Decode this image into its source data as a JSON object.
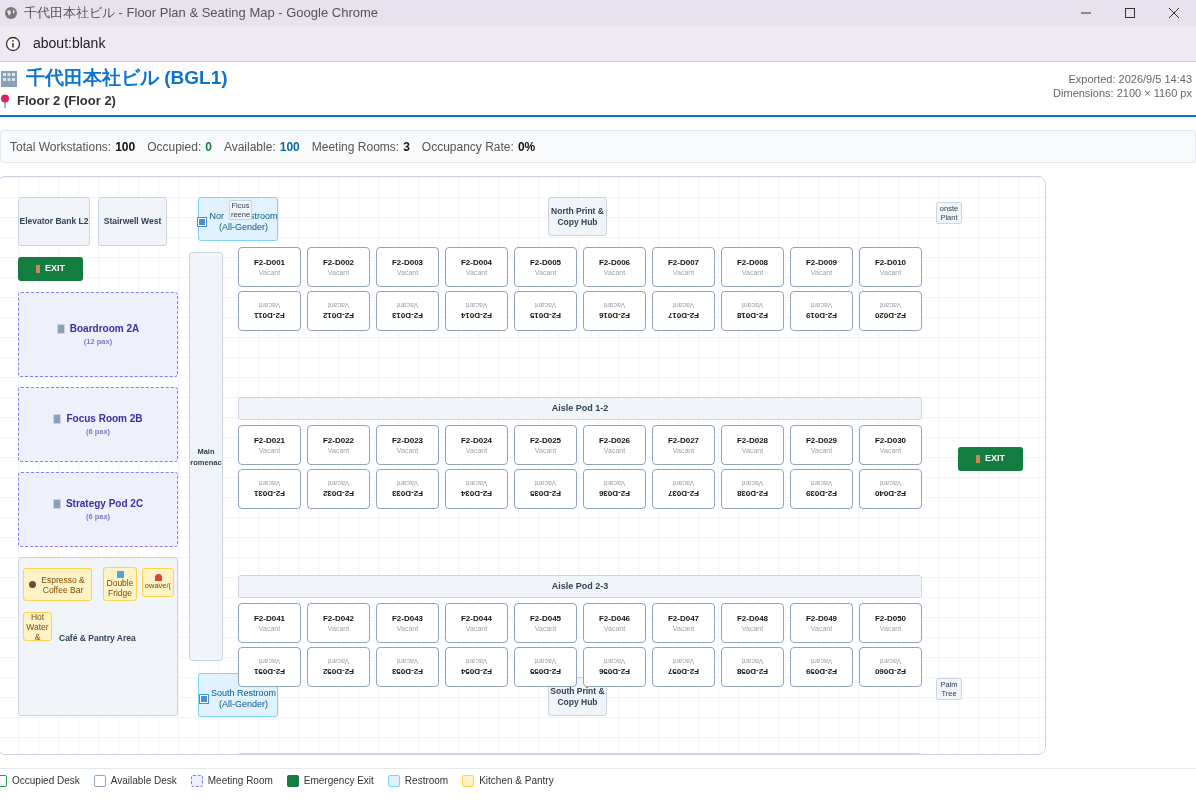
{
  "window": {
    "title": "千代田本社ビル - Floor Plan & Seating Map - Google Chrome"
  },
  "address_bar": {
    "url": "about:blank"
  },
  "header": {
    "building": "千代田本社ビル (BGL1)",
    "floor": "Floor 2 (Floor 2)",
    "exported": "Exported: 2026/9/5 14:43",
    "dimensions": "Dimensions: 2100 × 1160 px"
  },
  "stats": [
    {
      "label": "Total Workstations:",
      "value": "100",
      "kind": "total"
    },
    {
      "label": "Occupied:",
      "value": "0",
      "kind": "occupied"
    },
    {
      "label": "Available:",
      "value": "100",
      "kind": "available"
    },
    {
      "label": "Meeting Rooms:",
      "value": "3",
      "kind": "rooms"
    },
    {
      "label": "Occupancy Rate:",
      "value": "0%",
      "kind": "rate"
    }
  ],
  "floor_plan": {
    "facilities": [
      {
        "label": "Elevator Bank L2"
      },
      {
        "label": "Stairwell West"
      },
      {
        "label": "North Print & Copy Hub"
      },
      {
        "label": "South Print & Copy Hub"
      }
    ],
    "restrooms": [
      {
        "label": "Nor",
        "label_end": "stroom",
        "note": "(All-Gender)"
      },
      {
        "label": "South Restroom",
        "note": "(All-Gender)"
      }
    ],
    "exits": [
      {
        "label": "EXIT"
      },
      {
        "label": "EXIT"
      }
    ],
    "meeting_rooms": [
      {
        "name": "Boardroom 2A",
        "capacity": "(12 pax)"
      },
      {
        "name": "Focus Room 2B",
        "capacity": "(6 pax)"
      },
      {
        "name": "Strategy Pod 2C",
        "capacity": "(6 pax)"
      }
    ],
    "pantry": {
      "label": "Café & Pantry Area",
      "items": [
        {
          "kind": "coffee",
          "label": "Espresso & Coffee Bar"
        },
        {
          "kind": "fridge",
          "label": "Double Fridge"
        },
        {
          "kind": "microwave",
          "label": "owave/("
        },
        {
          "kind": "water",
          "label": "Hot Water &"
        }
      ]
    },
    "promenade": {
      "label": "Main romenac"
    },
    "plants": [
      {
        "label": "Ficus reene"
      },
      {
        "label": "onste Plant"
      },
      {
        "label": "Palm Tree"
      }
    ],
    "pods": [
      {
        "desks": [
          {
            "id": "F2-D001",
            "status": "Vacant",
            "occupied": false
          },
          {
            "id": "F2-D002",
            "status": "Vacant",
            "occupied": false
          },
          {
            "id": "F2-D003",
            "status": "Vacant",
            "occupied": false
          },
          {
            "id": "F2-D004",
            "status": "Vacant",
            "occupied": false
          },
          {
            "id": "F2-D005",
            "status": "Vacant",
            "occupied": false
          },
          {
            "id": "F2-D006",
            "status": "Vacant",
            "occupied": false
          },
          {
            "id": "F2-D007",
            "status": "Vacant",
            "occupied": false
          },
          {
            "id": "F2-D008",
            "status": "Vacant",
            "occupied": false
          },
          {
            "id": "F2-D009",
            "status": "Vacant",
            "occupied": false
          },
          {
            "id": "F2-D010",
            "status": "Vacant",
            "occupied": false
          },
          {
            "id": "F2-D011",
            "status": "Vacant",
            "occupied": false
          },
          {
            "id": "F2-D012",
            "status": "Vacant",
            "occupied": false
          },
          {
            "id": "F2-D013",
            "status": "Vacant",
            "occupied": false
          },
          {
            "id": "F2-D014",
            "status": "Vacant",
            "occupied": false
          },
          {
            "id": "F2-D015",
            "status": "Vacant",
            "occupied": false
          },
          {
            "id": "F2-D016",
            "status": "Vacant",
            "occupied": false
          },
          {
            "id": "F2-D017",
            "status": "Vacant",
            "occupied": false
          },
          {
            "id": "F2-D018",
            "status": "Vacant",
            "occupied": false
          },
          {
            "id": "F2-D019",
            "status": "Vacant",
            "occupied": false
          },
          {
            "id": "F2-D020",
            "status": "Vacant",
            "occupied": false
          }
        ]
      },
      {
        "label": "Aisle Pod 1-2",
        "desks": [
          {
            "id": "F2-D021",
            "status": "Vacant",
            "occupied": false
          },
          {
            "id": "F2-D022",
            "status": "Vacant",
            "occupied": false
          },
          {
            "id": "F2-D023",
            "status": "Vacant",
            "occupied": false
          },
          {
            "id": "F2-D024",
            "status": "Vacant",
            "occupied": false
          },
          {
            "id": "F2-D025",
            "status": "Vacant",
            "occupied": false
          },
          {
            "id": "F2-D026",
            "status": "Vacant",
            "occupied": false
          },
          {
            "id": "F2-D027",
            "status": "Vacant",
            "occupied": false
          },
          {
            "id": "F2-D028",
            "status": "Vacant",
            "occupied": false
          },
          {
            "id": "F2-D029",
            "status": "Vacant",
            "occupied": false
          },
          {
            "id": "F2-D030",
            "status": "Vacant",
            "occupied": false
          },
          {
            "id": "F2-D031",
            "status": "Vacant",
            "occupied": false
          },
          {
            "id": "F2-D032",
            "status": "Vacant",
            "occupied": false
          },
          {
            "id": "F2-D033",
            "status": "Vacant",
            "occupied": false
          },
          {
            "id": "F2-D034",
            "status": "Vacant",
            "occupied": false
          },
          {
            "id": "F2-D035",
            "status": "Vacant",
            "occupied": false
          },
          {
            "id": "F2-D036",
            "status": "Vacant",
            "occupied": false
          },
          {
            "id": "F2-D037",
            "status": "Vacant",
            "occupied": false
          },
          {
            "id": "F2-D038",
            "status": "Vacant",
            "occupied": false
          },
          {
            "id": "F2-D039",
            "status": "Vacant",
            "occupied": false
          },
          {
            "id": "F2-D040",
            "status": "Vacant",
            "occupied": false
          }
        ]
      },
      {
        "label": "Aisle Pod 2-3",
        "desks": [
          {
            "id": "F2-D041",
            "status": "Vacant",
            "occupied": false
          },
          {
            "id": "F2-D042",
            "status": "Vacant",
            "occupied": false
          },
          {
            "id": "F2-D043",
            "status": "Vacant",
            "occupied": false
          },
          {
            "id": "F2-D044",
            "status": "Vacant",
            "occupied": false
          },
          {
            "id": "F2-D045",
            "status": "Vacant",
            "occupied": false
          },
          {
            "id": "F2-D046",
            "status": "Vacant",
            "occupied": false
          },
          {
            "id": "F2-D047",
            "status": "Vacant",
            "occupied": false
          },
          {
            "id": "F2-D048",
            "status": "Vacant",
            "occupied": false
          },
          {
            "id": "F2-D049",
            "status": "Vacant",
            "occupied": false
          },
          {
            "id": "F2-D050",
            "status": "Vacant",
            "occupied": false
          },
          {
            "id": "F2-D051",
            "status": "Vacant",
            "occupied": false
          },
          {
            "id": "F2-D052",
            "status": "Vacant",
            "occupied": false
          },
          {
            "id": "F2-D053",
            "status": "Vacant",
            "occupied": false
          },
          {
            "id": "F2-D054",
            "status": "Vacant",
            "occupied": false
          },
          {
            "id": "F2-D055",
            "status": "Vacant",
            "occupied": false
          },
          {
            "id": "F2-D056",
            "status": "Vacant",
            "occupied": false
          },
          {
            "id": "F2-D057",
            "status": "Vacant",
            "occupied": false
          },
          {
            "id": "F2-D058",
            "status": "Vacant",
            "occupied": false
          },
          {
            "id": "F2-D059",
            "status": "Vacant",
            "occupied": false
          },
          {
            "id": "F2-D060",
            "status": "Vacant",
            "occupied": false
          }
        ]
      }
    ]
  },
  "legend": [
    {
      "kind": "occupied",
      "label": "Occupied Desk"
    },
    {
      "kind": "available",
      "label": "Available Desk"
    },
    {
      "kind": "meeting",
      "label": "Meeting Room"
    },
    {
      "kind": "exit",
      "label": "Emergency Exit"
    },
    {
      "kind": "restroom",
      "label": "Restroom"
    },
    {
      "kind": "pantry",
      "label": "Kitchen & Pantry"
    }
  ]
}
